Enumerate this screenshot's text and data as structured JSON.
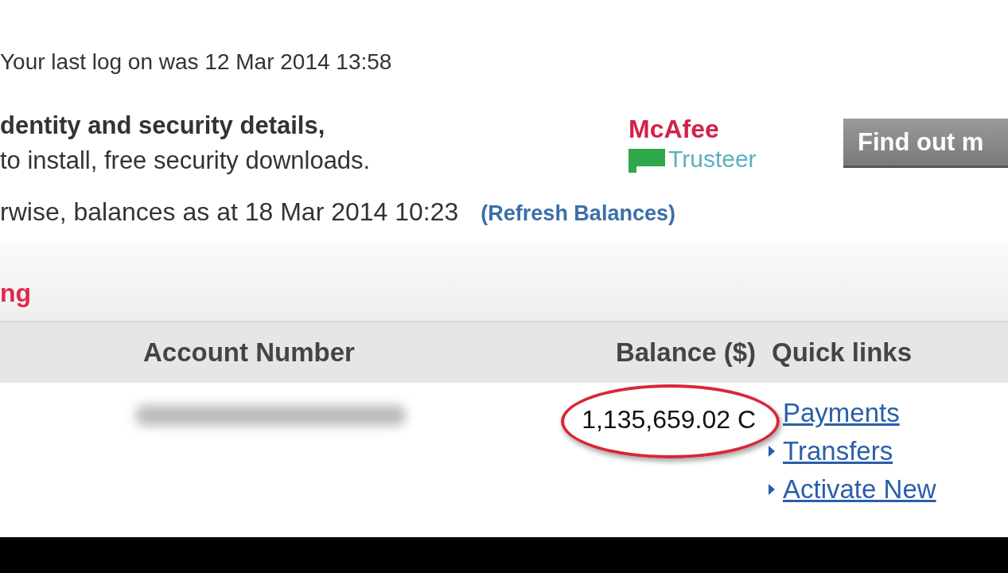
{
  "last_logon": "Your last log on was 12 Mar 2014 13:58",
  "security": {
    "lines": [
      "dentity and security details,",
      "to install, free security downloads."
    ],
    "logos": [
      {
        "kind": "mcafee",
        "text": "McAfee"
      },
      {
        "kind": "trusteer",
        "text": "Trusteer"
      }
    ],
    "button": "Find out m"
  },
  "balances_note": {
    "text": "rwise, balances as at 18 Mar 2014 10:23",
    "link": "(Refresh Balances)"
  },
  "section_title": "ng",
  "table": {
    "columns": [
      "Account Number",
      "Balance ($)",
      "Quick links"
    ],
    "rows": [
      {
        "balance": "1,135,659.02 C",
        "highlighted": true,
        "links": [
          {
            "label": "Payments",
            "bullet": false
          },
          {
            "label": "Transfers",
            "bullet": true
          },
          {
            "label": "Activate New",
            "bullet": true
          }
        ]
      }
    ]
  }
}
